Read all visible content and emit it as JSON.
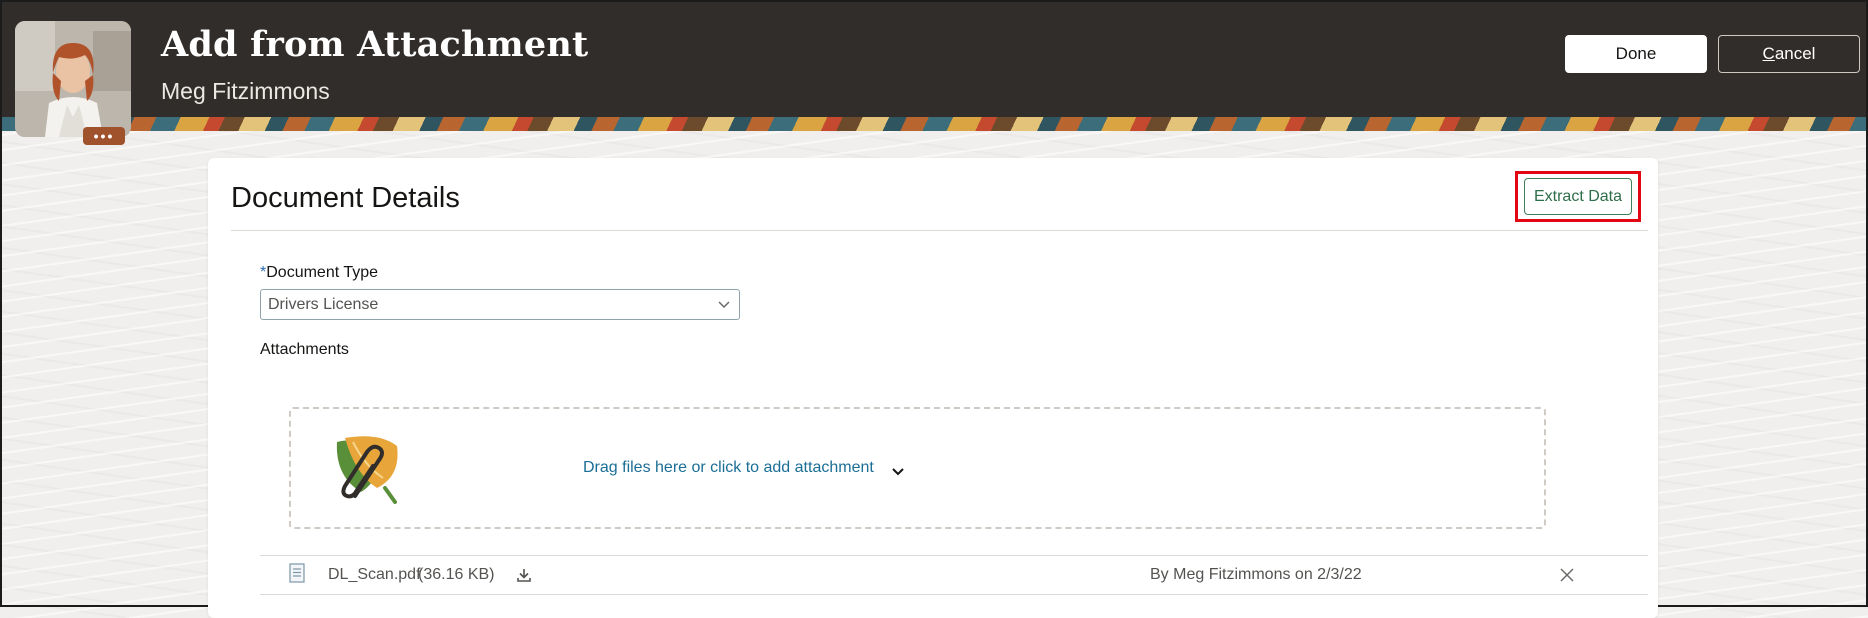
{
  "header": {
    "title": "Add from Attachment",
    "subtitle": "Meg Fitzimmons",
    "avatar_icon": "person-photo-icon",
    "more_menu_label": "•••",
    "done_label": "Done",
    "cancel_accel": "C",
    "cancel_rest": "ancel"
  },
  "card": {
    "title": "Document Details",
    "extract_label": "Extract Data",
    "document_type": {
      "required_marker": "*",
      "label": "Document Type",
      "value": "Drivers License"
    },
    "attachments": {
      "label": "Attachments",
      "dropzone_text": "Drag files here or click to add attachment",
      "files": [
        {
          "name": "DL_Scan.pdf",
          "size": "(36.16 KB)",
          "meta": "By Meg Fitzimmons on 2/3/22"
        }
      ]
    }
  },
  "colors": {
    "header_bg": "#312d2a",
    "accent_green": "#2e6e4a",
    "link_blue": "#1b6e95",
    "highlight_red": "#e30613"
  }
}
